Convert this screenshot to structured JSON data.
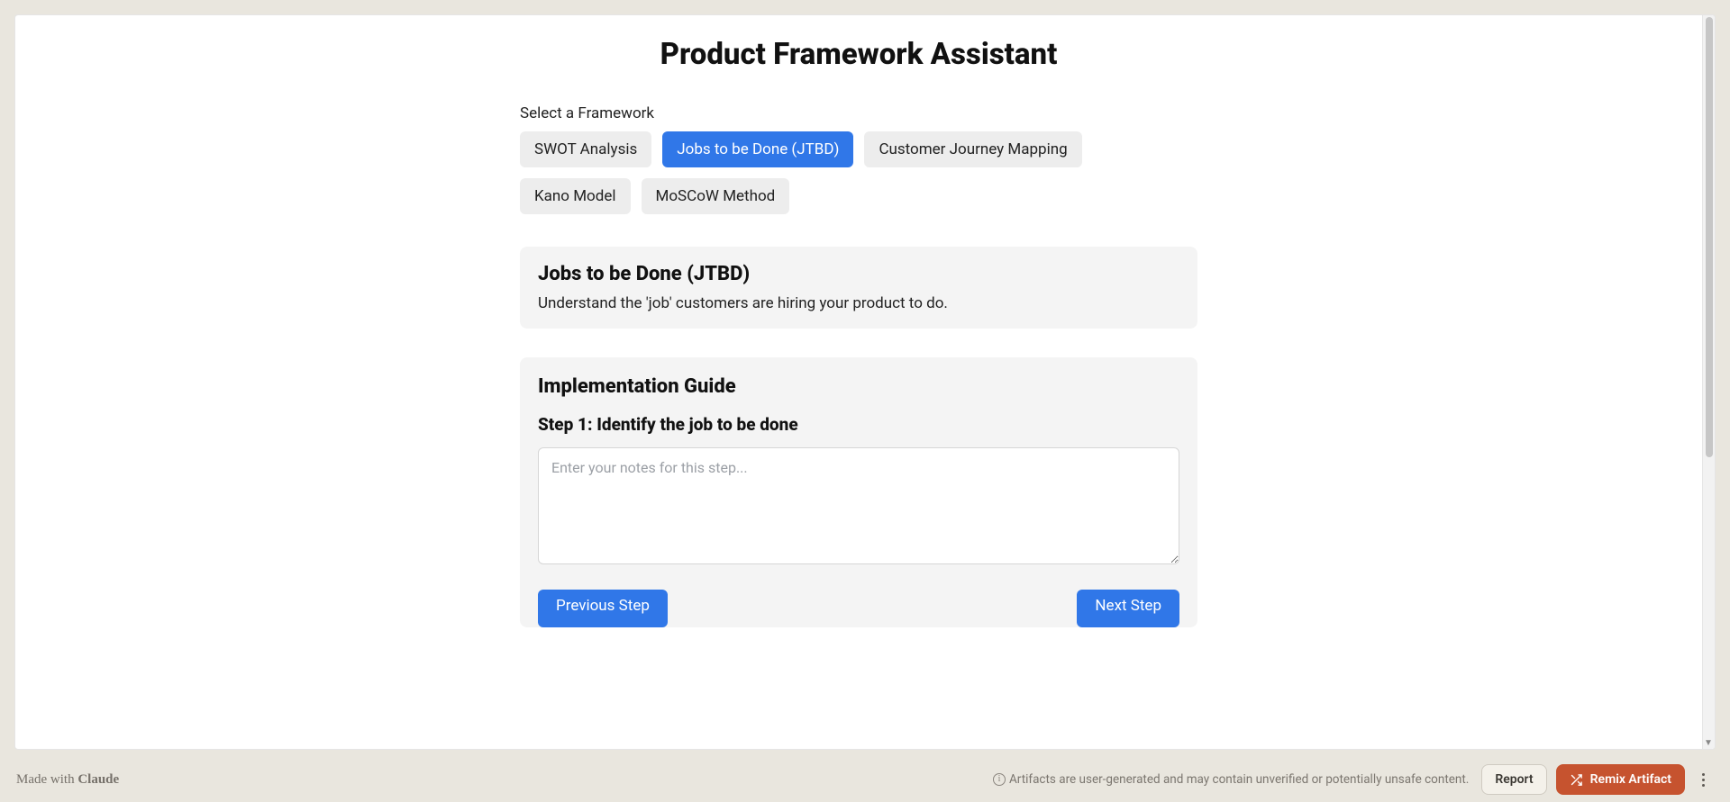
{
  "page_title": "Product Framework Assistant",
  "select_label": "Select a Framework",
  "frameworks": [
    {
      "label": "SWOT Analysis",
      "active": false
    },
    {
      "label": "Jobs to be Done (JTBD)",
      "active": true
    },
    {
      "label": "Customer Journey Mapping",
      "active": false
    },
    {
      "label": "Kano Model",
      "active": false
    },
    {
      "label": "MoSCoW Method",
      "active": false
    }
  ],
  "framework_detail": {
    "title": "Jobs to be Done (JTBD)",
    "description": "Understand the 'job' customers are hiring your product to do."
  },
  "guide": {
    "heading": "Implementation Guide",
    "step_label": "Step 1: Identify the job to be done",
    "notes_placeholder": "Enter your notes for this step...",
    "notes_value": "",
    "prev_label": "Previous Step",
    "next_label": "Next Step"
  },
  "footer": {
    "made_with_prefix": "Made with ",
    "made_with_brand": "Claude",
    "disclaimer": "Artifacts are user-generated and may contain unverified or potentially unsafe content.",
    "report_label": "Report",
    "remix_label": "Remix Artifact"
  }
}
